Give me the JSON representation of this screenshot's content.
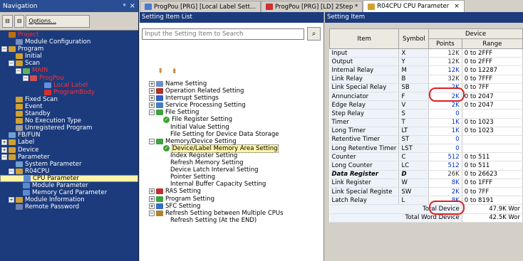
{
  "navigation": {
    "title": "Navigation",
    "pin": "ᵠ",
    "close": "×",
    "toolbar": {
      "btn1": "⊟",
      "btn2": "⊟",
      "options_label": "Options..."
    },
    "tree": [
      {
        "label": "Project",
        "indent": 0,
        "toggle": "",
        "color": "red",
        "icon": "#c07010"
      },
      {
        "label": "Module Configuration",
        "indent": 1,
        "toggle": "",
        "icon": "#7a8cc0"
      },
      {
        "label": "Program",
        "indent": 0,
        "toggle": "−",
        "icon": "#d0a030"
      },
      {
        "label": "Initial",
        "indent": 1,
        "toggle": "",
        "icon": "#d0a030"
      },
      {
        "label": "Scan",
        "indent": 1,
        "toggle": "−",
        "icon": "#d0a030"
      },
      {
        "label": "MAIN",
        "indent": 2,
        "toggle": "−",
        "color": "red",
        "icon": "#60b060"
      },
      {
        "label": "ProgPou",
        "indent": 3,
        "toggle": "−",
        "color": "red",
        "icon": "#d05050"
      },
      {
        "label": "Local Label",
        "indent": 5,
        "toggle": "",
        "color": "red",
        "icon": "#6090e0"
      },
      {
        "label": "ProgramBody",
        "indent": 5,
        "toggle": "",
        "color": "red",
        "icon": "#d03030"
      },
      {
        "label": "Fixed Scan",
        "indent": 1,
        "toggle": "",
        "icon": "#d0a030"
      },
      {
        "label": "Event",
        "indent": 1,
        "toggle": "",
        "icon": "#d0a030"
      },
      {
        "label": "Standby",
        "indent": 1,
        "toggle": "",
        "icon": "#d0a030"
      },
      {
        "label": "No Execution Type",
        "indent": 1,
        "toggle": "",
        "icon": "#d0a030"
      },
      {
        "label": "Unregistered Program",
        "indent": 1,
        "toggle": "",
        "icon": "#a0a0a0"
      },
      {
        "label": "FB/FUN",
        "indent": 0,
        "toggle": "",
        "icon": "#70a0d0"
      },
      {
        "label": "Label",
        "indent": 0,
        "toggle": "+",
        "icon": "#d0a030"
      },
      {
        "label": "Device",
        "indent": 0,
        "toggle": "+",
        "icon": "#d0a030"
      },
      {
        "label": "Parameter",
        "indent": 0,
        "toggle": "−",
        "icon": "#d0a030"
      },
      {
        "label": "System Parameter",
        "indent": 1,
        "toggle": "",
        "icon": "#70a0d0"
      },
      {
        "label": "R04CPU",
        "indent": 1,
        "toggle": "−",
        "icon": "#d0a030"
      },
      {
        "label": "CPU Parameter",
        "indent": 2,
        "toggle": "",
        "icon": "#5a8ad0",
        "selected": true
      },
      {
        "label": "Module Parameter",
        "indent": 2,
        "toggle": "",
        "icon": "#5a8ad0"
      },
      {
        "label": "Memory Card Parameter",
        "indent": 2,
        "toggle": "",
        "icon": "#5a8ad0"
      },
      {
        "label": "Module Information",
        "indent": 1,
        "toggle": "+",
        "icon": "#d0a030"
      },
      {
        "label": "Remote Password",
        "indent": 1,
        "toggle": "",
        "icon": "#7080b0"
      }
    ]
  },
  "tabs": [
    {
      "label": "ProgPou [PRG] [Local Label Sett...",
      "icon": "#4a7ad0",
      "active": false
    },
    {
      "label": "ProgPou [PRG] [LD] 2Step *",
      "icon": "#d03030",
      "active": false
    },
    {
      "label": "R04CPU CPU Parameter",
      "icon": "#d0a030",
      "active": true,
      "close": "×"
    }
  ],
  "setting_list": {
    "title": "Setting Item List",
    "search_placeholder": "Input the Setting Item to Search",
    "search_button": "⌕",
    "toolbar_icons": "⇞ ⇟",
    "tree": [
      {
        "label": "Name Setting",
        "toggle": "+",
        "indent": 0,
        "icon": "#6a90c8"
      },
      {
        "label": "Operation Related Setting",
        "toggle": "+",
        "indent": 0,
        "icon": "#b03030"
      },
      {
        "label": "Interrupt Settings",
        "toggle": "+",
        "indent": 0,
        "icon": "#3060c0"
      },
      {
        "label": "Service Processing Setting",
        "toggle": "+",
        "indent": 0,
        "icon": "#4080c0"
      },
      {
        "label": "File Setting",
        "toggle": "−",
        "indent": 0,
        "icon": "#40a040"
      },
      {
        "label": "File Register Setting",
        "toggle": "",
        "indent": 1,
        "check": true
      },
      {
        "label": "Initial Value Setting",
        "toggle": "",
        "indent": 2
      },
      {
        "label": "File Setting for Device Data Storage",
        "toggle": "",
        "indent": 2
      },
      {
        "label": "Memory/Device Setting",
        "toggle": "−",
        "indent": 0,
        "icon": "#40a040"
      },
      {
        "label": "Device/Label Memory Area Setting",
        "toggle": "",
        "indent": 1,
        "check": true,
        "selected": true
      },
      {
        "label": "Index Register Setting",
        "toggle": "",
        "indent": 2
      },
      {
        "label": "Refresh Memory Setting",
        "toggle": "",
        "indent": 2
      },
      {
        "label": "Device Latch Interval Setting",
        "toggle": "",
        "indent": 2
      },
      {
        "label": "Pointer Setting",
        "toggle": "",
        "indent": 2
      },
      {
        "label": "Internal Buffer Capacity Setting",
        "toggle": "",
        "indent": 2
      },
      {
        "label": "RAS Setting",
        "toggle": "+",
        "indent": 0,
        "icon": "#c03030"
      },
      {
        "label": "Program Setting",
        "toggle": "+",
        "indent": 0,
        "icon": "#40a040"
      },
      {
        "label": "SFC Setting",
        "toggle": "+",
        "indent": 0,
        "icon": "#3070c0"
      },
      {
        "label": "Refresh Setting between Multiple CPUs",
        "toggle": "−",
        "indent": 0,
        "icon": "#b08030"
      },
      {
        "label": "Refresh Setting (At the END)",
        "toggle": "",
        "indent": 2
      }
    ]
  },
  "setting_item": {
    "title": "Setting Item",
    "headers": {
      "item": "Item",
      "symbol": "Symbol",
      "device": "Device",
      "points": "Points",
      "range": "Range"
    },
    "rows": [
      {
        "item": "Input",
        "symbol": "X",
        "points": "12K",
        "range": "0 to 2FFF",
        "blue": false
      },
      {
        "item": "Output",
        "symbol": "Y",
        "points": "12K",
        "range": "0 to 2FFF",
        "blue": false
      },
      {
        "item": "Internal Relay",
        "symbol": "M",
        "points": "12K",
        "range": "0 to 12287",
        "blue": true
      },
      {
        "item": "Link Relay",
        "symbol": "B",
        "points": "32K",
        "range": "0 to 7FFF",
        "blue": false
      },
      {
        "item": "Link Special Relay",
        "symbol": "SB",
        "points": "2K",
        "range": "0 to 7FF",
        "blue": true
      },
      {
        "item": "Annunciator",
        "symbol": "F",
        "points": "2K",
        "range": "0 to 2047",
        "blue": true
      },
      {
        "item": "Edge Relay",
        "symbol": "V",
        "points": "2K",
        "range": "0 to 2047",
        "blue": true
      },
      {
        "item": "Step Relay",
        "symbol": "S",
        "points": "0",
        "range": "",
        "blue": true
      },
      {
        "item": "Timer",
        "symbol": "T",
        "points": "1K",
        "range": "0 to 1023",
        "blue": true
      },
      {
        "item": "Long Timer",
        "symbol": "LT",
        "points": "1K",
        "range": "0 to 1023",
        "blue": true
      },
      {
        "item": "Retentive Timer",
        "symbol": "ST",
        "points": "0",
        "range": "",
        "blue": true
      },
      {
        "item": "Long Retentive Timer",
        "symbol": "LST",
        "points": "0",
        "range": "",
        "blue": true
      },
      {
        "item": "Counter",
        "symbol": "C",
        "points": "512",
        "range": "0 to 511",
        "blue": true
      },
      {
        "item": "Long Counter",
        "symbol": "LC",
        "points": "512",
        "range": "0 to 511",
        "blue": true
      },
      {
        "item": "Data Register",
        "symbol": "D",
        "points": "26K",
        "range": "0 to 26623",
        "blue": false,
        "bold": true
      },
      {
        "item": "Link Register",
        "symbol": "W",
        "points": "8K",
        "range": "0 to 1FFF",
        "blue": true
      },
      {
        "item": "Link Special Registe",
        "symbol": "SW",
        "points": "2K",
        "range": "0 to 7FF",
        "blue": true
      },
      {
        "item": "Latch Relay",
        "symbol": "L",
        "points": "8K",
        "range": "0 to 8191",
        "blue": true
      }
    ],
    "totals": [
      {
        "label": "Total Device",
        "value": "47.9K Wor"
      },
      {
        "label": "Total Word Device",
        "value": "42.5K Wor"
      }
    ]
  }
}
